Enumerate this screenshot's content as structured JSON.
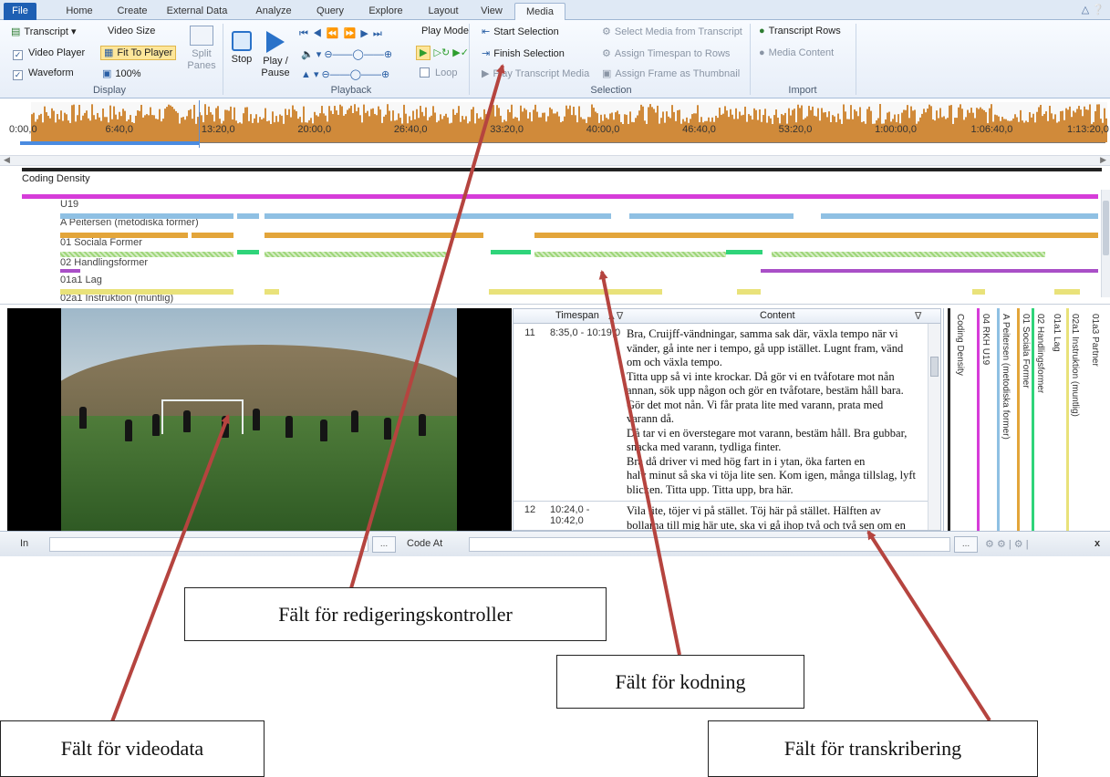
{
  "tabs": [
    "File",
    "Home",
    "Create",
    "External Data",
    "Analyze",
    "Query",
    "Explore",
    "Layout",
    "View",
    "Media"
  ],
  "active_tab": "Media",
  "ribbon": {
    "display": {
      "label": "Display",
      "transcript": "Transcript",
      "video_player": "Video Player",
      "waveform": "Waveform",
      "video_size": "Video Size",
      "fit_to_player": "Fit To Player",
      "zoom": "100%",
      "split_panes_1": "Split",
      "split_panes_2": "Panes"
    },
    "playback": {
      "label": "Playback",
      "stop": "Stop",
      "play_1": "Play /",
      "play_2": "Pause",
      "play_mode": "Play Mode",
      "loop": "Loop"
    },
    "selection": {
      "label": "Selection",
      "start_selection": "Start Selection",
      "finish_selection": "Finish Selection",
      "play_transcript_media": "Play Transcript Media",
      "select_media": "Select Media from Transcript",
      "assign_timespan": "Assign Timespan to Rows",
      "assign_frame": "Assign Frame as Thumbnail"
    },
    "import": {
      "label": "Import",
      "transcript_rows": "Transcript Rows",
      "media_content": "Media Content"
    }
  },
  "timeline": {
    "ticks": [
      "0:00,0",
      "6:40,0",
      "13:20,0",
      "20:00,0",
      "26:40,0",
      "33:20,0",
      "40:00,0",
      "46:40,0",
      "53:20,0",
      "1:00:00,0",
      "1:06:40,0",
      "1:13:20,0"
    ],
    "progress_fraction": 0.165
  },
  "coding": {
    "title": "Coding Density",
    "stripes": [
      "U19",
      "A Peitersen (metodiska former)",
      "01 Sociala Former",
      "02 Handlingsformer",
      "01a1 Lag",
      "02a1 Instruktion (muntlig)"
    ],
    "colors": {
      "u19": "#d63cd9",
      "peitersen": "#8fc0e3",
      "sociala": "#e3a53a",
      "handling": "#2fd47a",
      "lag": "#a94fc7",
      "instruktion": "#e9e27a"
    }
  },
  "transcript": {
    "col_timespan": "Timespan",
    "col_content": "Content",
    "rows": [
      {
        "num": "11",
        "timespan": "8:35,0 - 10:19,0",
        "lines": [
          "Bra, Cruijff-vändningar, samma sak där, växla tempo när vi",
          "vänder, gå inte ner i tempo, gå upp istället. Lugnt fram, vänd",
          "om och växla tempo.",
          "Titta upp så vi inte krockar. Då gör vi en tvåfotare mot nån",
          "annan, sök upp någon och gör en tvåfotare, bestäm håll bara.",
          "Gör det mot nån. Vi får prata lite med varann, prata med",
          "varann då.",
          "Då tar vi en överstegare mot varann, bestäm håll. Bra gubbar,",
          "snacka med varann, tydliga finter.",
          "Bra då driver vi med hög fart in i ytan, öka farten en",
          "halv minut så ska vi töja lite sen. Kom igen, många tillslag, lyft",
          "blicken. Titta upp. Titta upp, bra här."
        ]
      },
      {
        "num": "12",
        "timespan": "10:24,0 - 10:42,0",
        "lines": [
          "Vila lite, töjer vi på stället. Töj här på stället. Hälften av",
          "bollarna till mig här ute, ska vi gå ihop två och två sen om en"
        ]
      }
    ]
  },
  "vertical_stripes": [
    "Coding Density",
    "04 RKH U19",
    "A Peitersen (metodiska former)",
    "01 Sociala Former",
    "02 Handlingsformer",
    "01a1 Lag",
    "02a1 Instruktion (muntlig)",
    "01a3 Partner"
  ],
  "bottom": {
    "in_label": "In",
    "code_at_label": "Code At",
    "ellipsis": "...",
    "close": "x"
  },
  "callouts": {
    "editing": "Fält för redigeringskontroller",
    "coding": "Fält för kodning",
    "video": "Fält för videodata",
    "transcription": "Fält för transkribering"
  },
  "arrow_color": "#b5443f"
}
